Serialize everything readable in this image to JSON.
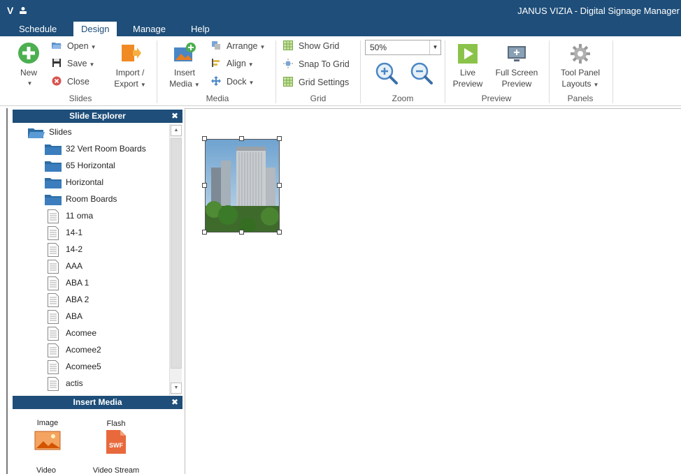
{
  "app": {
    "logo": "V",
    "title": "JANUS VIZIA - Digital Signage Manager"
  },
  "tabs": [
    {
      "label": "Schedule"
    },
    {
      "label": "Design"
    },
    {
      "label": "Manage"
    },
    {
      "label": "Help"
    }
  ],
  "ribbon": {
    "slides": {
      "group_label": "Slides",
      "new_label": "New",
      "open_label": "Open",
      "save_label": "Save",
      "close_label": "Close",
      "import_label": "Import /",
      "export_label": "Export"
    },
    "media": {
      "group_label": "Media",
      "insert_label": "Insert",
      "insert_media_label": "Media",
      "arrange_label": "Arrange",
      "align_label": "Align",
      "dock_label": "Dock"
    },
    "grid": {
      "group_label": "Grid",
      "show_grid_label": "Show Grid",
      "snap_label": "Snap To Grid",
      "settings_label": "Grid Settings"
    },
    "zoom": {
      "group_label": "Zoom",
      "value": "50%"
    },
    "preview": {
      "group_label": "Preview",
      "live_line1": "Live",
      "live_line2": "Preview",
      "full_line1": "Full Screen",
      "full_line2": "Preview"
    },
    "panels": {
      "group_label": "Panels",
      "tool_line1": "Tool Panel",
      "tool_line2": "Layouts"
    }
  },
  "slide_explorer": {
    "title": "Slide Explorer",
    "root": "Slides",
    "folders": [
      "32 Vert Room Boards",
      "65 Horizontal",
      "Horizontal",
      "Room Boards"
    ],
    "slides": [
      "11 oma",
      "14-1",
      "14-2",
      "AAA",
      "ABA 1",
      "ABA 2",
      "ABA",
      "Acomee",
      "Acomee2",
      "Acomee5",
      "actis"
    ]
  },
  "insert_media": {
    "title": "Insert Media",
    "items": [
      "Image",
      "Flash",
      "Video",
      "Video Stream"
    ]
  },
  "colors": {
    "accent": "#1e4e79",
    "folder": "#2e6da4",
    "green": "#4caf50",
    "orange": "#f08a24"
  }
}
